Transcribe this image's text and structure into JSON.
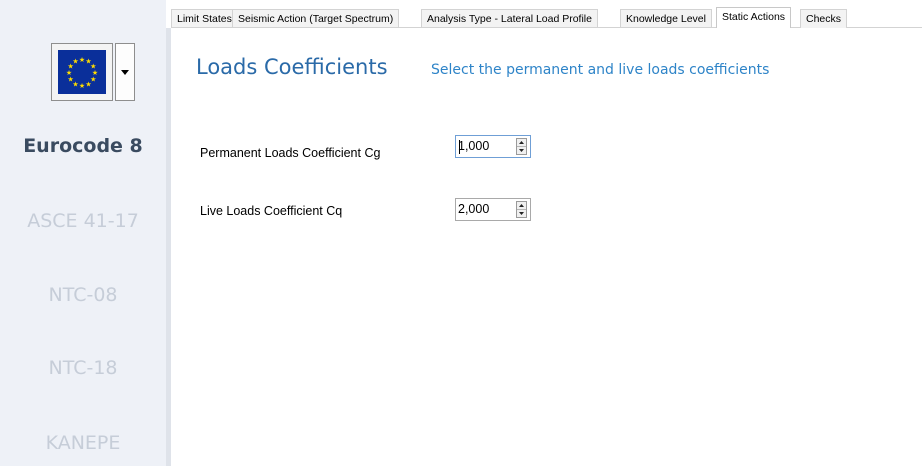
{
  "tabs": [
    {
      "label": "Limit States",
      "active": false
    },
    {
      "label": "Seismic Action (Target Spectrum)",
      "active": false
    },
    {
      "label": "Analysis Type - Lateral Load Profile",
      "active": false
    },
    {
      "label": "Knowledge Level",
      "active": false
    },
    {
      "label": "Static Actions",
      "active": true
    },
    {
      "label": "Checks",
      "active": false
    }
  ],
  "sidebar": {
    "flag_icon": "eu-flag-icon",
    "dropdown_icon": "chevron-down-icon",
    "codes": [
      {
        "label": "Eurocode 8",
        "active": true
      },
      {
        "label": "ASCE 41-17",
        "active": false
      },
      {
        "label": "NTC-08",
        "active": false
      },
      {
        "label": "NTC-18",
        "active": false
      },
      {
        "label": "KANEPE",
        "active": false
      }
    ]
  },
  "main": {
    "title": "Loads Coefficients",
    "subtitle": "Select the permanent and live loads coefficients",
    "fields": [
      {
        "label": "Permanent Loads Coefficient Cg",
        "value": "1,000"
      },
      {
        "label": "Live Loads Coefficient Cq",
        "value": "2,000"
      }
    ]
  },
  "colors": {
    "title": "#2a6aa8",
    "subtitle": "#2e84c8",
    "sidebar_bg": "#eef1f7",
    "active_code": "#3a4b60",
    "inactive_code": "#c6cdd8",
    "flag_blue": "#0a2f9a",
    "flag_star": "#ffdd00"
  }
}
